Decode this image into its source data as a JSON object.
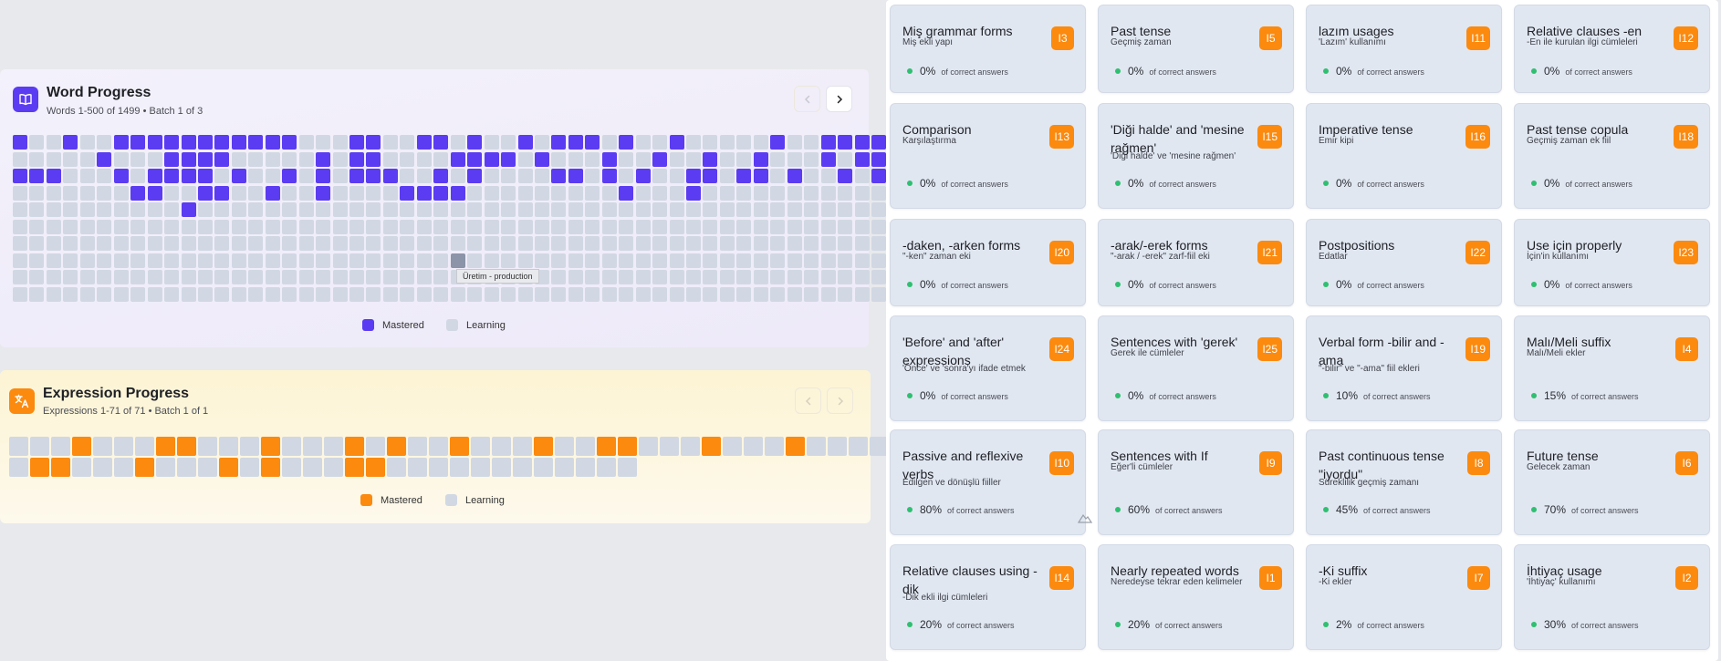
{
  "word_progress": {
    "title": "Word Progress",
    "subtitle": "Words 1-500 of 1499 • Batch 1 of 3",
    "icon": "book-icon",
    "prev_icon": "chevron-left-icon",
    "next_icon": "chevron-right-icon",
    "legend": {
      "mastered": "Mastered",
      "learning": "Learning"
    },
    "tooltip": "Üretim - production",
    "colors": {
      "mastered": "#5b3cf2",
      "learning": "#d1d8e3",
      "hover": "#8b94a8"
    },
    "grid_rows": [
      "1001001111111111100011001101001011101001000001001111",
      "0000010001111000001011000011110100010010010010001011",
      "1110001011110100101011100101000011010100110110100101",
      "0000000110011001001000011110000000001000100000000000",
      "0000000000100000000000000000000000000000000000000000",
      "0000000000000000000000000000000000000000000000000000",
      "0000000000000000000000000000000000000000000000000000",
      "0000000000000000000000000000000000000000000000000000",
      "0000000000000000000000000000000000000000000000000000",
      "0000000000000000000000000000000000000000000000000000"
    ]
  },
  "expression_progress": {
    "title": "Expression Progress",
    "subtitle": "Expressions 1-71 of 71 • Batch 1 of 1",
    "icon": "translate-icon",
    "prev_icon": "chevron-left-icon",
    "next_icon": "chevron-right-icon",
    "legend": {
      "mastered": "Mastered",
      "learning": "Learning"
    },
    "colors": {
      "mastered": "#fb8a0f",
      "learning": "#d1d8e3"
    },
    "grid_rows": [
      "00010001100010001010010001001100010001000001",
      "011000100010100011000000000000"
    ]
  },
  "lessons": [
    {
      "title": "Miş grammar forms",
      "subtitle": "Miş ekli yapı",
      "badge": "I3",
      "percent": "0%",
      "label": "of correct answers"
    },
    {
      "title": "Past tense",
      "subtitle": "Geçmiş zaman",
      "badge": "I5",
      "percent": "0%",
      "label": "of correct answers"
    },
    {
      "title": "lazım usages",
      "subtitle": "'Lazım' kullanımı",
      "badge": "I11",
      "percent": "0%",
      "label": "of correct answers"
    },
    {
      "title": "Relative clauses -en",
      "subtitle": "-En ile kurulan ilgi cümleleri",
      "badge": "I12",
      "percent": "0%",
      "label": "of correct answers"
    },
    {
      "title": "Comparison",
      "subtitle": "Karşılaştırma",
      "badge": "I13",
      "percent": "0%",
      "label": "of correct answers"
    },
    {
      "title": "'Diği halde' and 'mesine rağmen'",
      "subtitle": "'Diği halde' ve 'mesine rağmen'",
      "badge": "I15",
      "percent": "0%",
      "label": "of correct answers"
    },
    {
      "title": "Imperative tense",
      "subtitle": "Emir kipi",
      "badge": "I16",
      "percent": "0%",
      "label": "of correct answers"
    },
    {
      "title": "Past tense copula",
      "subtitle": "Geçmiş zaman ek fiil",
      "badge": "I18",
      "percent": "0%",
      "label": "of correct answers"
    },
    {
      "title": "-daken, -arken forms",
      "subtitle": "\"-ken\" zaman eki",
      "badge": "I20",
      "percent": "0%",
      "label": "of correct answers"
    },
    {
      "title": "-arak/-erek forms",
      "subtitle": "\"-arak / -erek\" zarf-fiil eki",
      "badge": "I21",
      "percent": "0%",
      "label": "of correct answers"
    },
    {
      "title": "Postpositions",
      "subtitle": "Edatlar",
      "badge": "I22",
      "percent": "0%",
      "label": "of correct answers"
    },
    {
      "title": "Use için properly",
      "subtitle": "İçin'in kullanımı",
      "badge": "I23",
      "percent": "0%",
      "label": "of correct answers"
    },
    {
      "title": "'Before' and 'after' expressions",
      "subtitle": "'Önce' ve 'sonra'yı ifade etmek",
      "badge": "I24",
      "percent": "0%",
      "label": "of correct answers"
    },
    {
      "title": "Sentences with 'gerek'",
      "subtitle": "Gerek ile cümleler",
      "badge": "I25",
      "percent": "0%",
      "label": "of correct answers"
    },
    {
      "title": "Verbal form -bilir and -ama",
      "subtitle": "\"-bilir\" ve \"-ama\" fiil ekleri",
      "badge": "I19",
      "percent": "10%",
      "label": "of correct answers"
    },
    {
      "title": "Malı/Meli suffix",
      "subtitle": "Malı/Meli ekler",
      "badge": "I4",
      "percent": "15%",
      "label": "of correct answers"
    },
    {
      "title": "Passive and reflexive verbs",
      "subtitle": "Edilgen ve dönüşlü fiiller",
      "badge": "I10",
      "percent": "80%",
      "label": "of correct answers"
    },
    {
      "title": "Sentences with If",
      "subtitle": "Eğer'li cümleler",
      "badge": "I9",
      "percent": "60%",
      "label": "of correct answers"
    },
    {
      "title": "Past continuous tense \"iyordu\"",
      "subtitle": "Süreklilik geçmiş zamanı",
      "badge": "I8",
      "percent": "45%",
      "label": "of correct answers"
    },
    {
      "title": "Future tense",
      "subtitle": "Gelecek zaman",
      "badge": "I6",
      "percent": "70%",
      "label": "of correct answers"
    },
    {
      "title": "Relative clauses using -dik",
      "subtitle": "-Dik ekli ilgi cümleleri",
      "badge": "I14",
      "percent": "20%",
      "label": "of correct answers"
    },
    {
      "title": "Nearly repeated words",
      "subtitle": "Neredeyse tekrar eden kelimeler",
      "badge": "I1",
      "percent": "20%",
      "label": "of correct answers"
    },
    {
      "title": "-Ki suffix",
      "subtitle": "-Ki ekler",
      "badge": "I7",
      "percent": "2%",
      "label": "of correct answers"
    },
    {
      "title": "İhtiyaç usage",
      "subtitle": "'İhtiyaç' kullanımı",
      "badge": "I2",
      "percent": "30%",
      "label": "of correct answers"
    }
  ]
}
